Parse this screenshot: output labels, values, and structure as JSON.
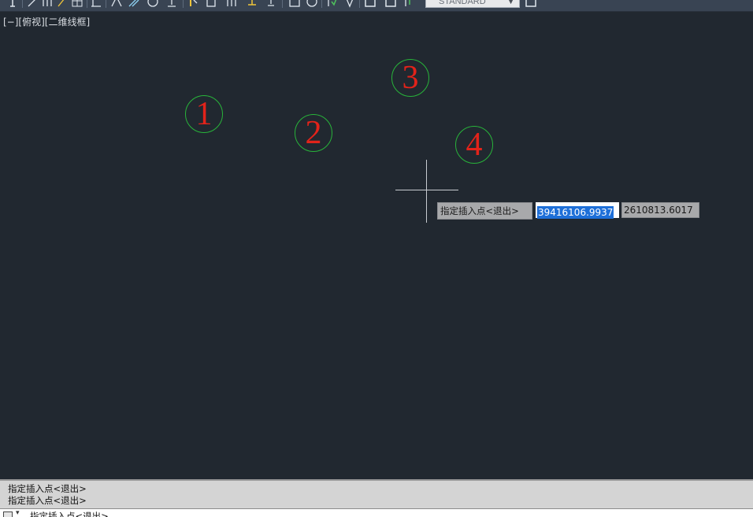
{
  "toolbar": {
    "text_style": "STANDARD",
    "icons": [
      "text-icon",
      "line-icon",
      "polyline-icon",
      "leader-icon",
      "table-icon",
      "arc-icon",
      "angle-icon",
      "circle-icon",
      "underline-icon",
      "pointer-icon",
      "block-icon",
      "attribute-icon",
      "insert-icon",
      "dimension-icon",
      "point-icon",
      "box-icon",
      "arc-tool-icon",
      "check-icon",
      "symbol-icon",
      "layout-icon",
      "layout-alt-icon",
      "refresh-icon",
      "dropdown-icon",
      "window-icon"
    ]
  },
  "viewport": {
    "label": "[−][俯视][二维线框]"
  },
  "markers": [
    {
      "label": "1",
      "glyph": "①"
    },
    {
      "label": "2",
      "glyph": "②"
    },
    {
      "label": "3",
      "glyph": "③"
    },
    {
      "label": "4",
      "glyph": "④"
    }
  ],
  "colors": {
    "background": "#212830",
    "marker_circle": "#28b43a",
    "marker_number": "#e2231a",
    "selection": "#1e6fd8"
  },
  "dynamic_input": {
    "prompt": "指定插入点<退出>",
    "x_value": "39416106.9937",
    "y_value": "2610813.6017"
  },
  "command_history": [
    "指定插入点<退出>",
    "指定插入点<退出>"
  ],
  "command_line": {
    "prompt": "指定插入点<退出>"
  }
}
